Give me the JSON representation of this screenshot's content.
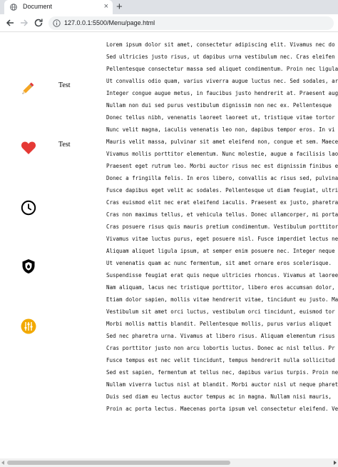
{
  "browser": {
    "tab_title": "Document",
    "tab_close": "×",
    "new_tab": "+",
    "url": "127.0.0.1:5500/Menu/page.html"
  },
  "menu": [
    {
      "icon": "pencil-icon",
      "label": "Test"
    },
    {
      "icon": "heart-icon",
      "label": "Test"
    },
    {
      "icon": "clock-icon",
      "label": ""
    },
    {
      "icon": "shield-icon",
      "label": ""
    },
    {
      "icon": "sliders-icon",
      "label": ""
    }
  ],
  "colors": {
    "heart": "#e53935",
    "sliders_bg": "#f2a900",
    "pencil_body": "#f5a623",
    "pencil_tip": "#e53935"
  },
  "content_lines": [
    "Lorem ipsum dolor sit amet, consectetur adipiscing elit. Vivamus nec do",
    "Sed ultricies justo risus, ut dapibus urna vestibulum nec. Cras eleifen",
    "Pellentesque consectetur massa sed aliquet condimentum. Proin nec ligula",
    "Ut convallis odio quam, varius viverra augue luctus nec. Sed sodales, ar",
    "Integer congue augue metus, in faucibus justo hendrerit at. Praesent aug",
    "Nullam non dui sed purus vestibulum dignissim non nec ex. Pellentesque",
    "Donec tellus nibh, venenatis laoreet laoreet ut, tristique vitae tortor",
    "Nunc velit magna, iaculis venenatis leo non, dapibus tempor eros. In vi",
    "Mauris velit massa, pulvinar sit amet eleifend non, congue et sem. Maece",
    "Vivamus mollis porttitor elementum. Nunc molestie, augue a facilisis lao",
    "Praesent eget rutrum leo. Morbi auctor risus nec est dignissim finibus e",
    "Donec a fringilla felis. In eros libero, convallis ac risus sed, pulvina",
    "Fusce dapibus eget velit ac sodales. Pellentesque ut diam feugiat, ultri",
    "Cras euismod elit nec erat eleifend iaculis. Praesent ex justo, pharetra",
    "Cras non maximus tellus, et vehicula tellus. Donec ullamcorper, mi porta",
    "Cras posuere risus quis mauris pretium condimentum. Vestibulum porttitor",
    "Vivamus vitae luctus purus, eget posuere nisl. Fusce imperdiet lectus ne",
    "Aliquam aliquet ligula ipsum, at semper enim posuere nec. Integer neque",
    "Ut venenatis quam ac nunc fermentum, sit amet ornare eros scelerisque.",
    "Suspendisse feugiat erat quis neque ultricies rhoncus. Vivamus at laoree",
    "Nam aliquam, lacus nec tristique porttitor, libero eros accumsan dolor,",
    "Etiam dolor sapien, mollis vitae hendrerit vitae, tincidunt eu justo. Ma",
    "Vestibulum sit amet orci luctus, vestibulum orci tincidunt, euismod tor",
    "Morbi mollis mattis blandit. Pellentesque mollis, purus varius aliquet",
    "Sed nec pharetra urna. Vivamus at libero risus. Aliquam elementum risus",
    "Cras porttitor justo non arcu lobortis luctus. Donec ac nisl tellus. Pr",
    "Fusce tempus est nec velit tincidunt, tempus hendrerit nulla sollicitud",
    "Sed est sapien, fermentum at tellus nec, dapibus varius turpis. Proin ne",
    "Nullam viverra luctus nisl at blandit. Morbi auctor nisl ut neque pharet",
    "Duis sed diam eu lectus auctor tempus ac in magna. Nullam nisi mauris,",
    "Proin ac porta lectus. Maecenas porta ipsum vel consectetur eleifend. Ve"
  ]
}
